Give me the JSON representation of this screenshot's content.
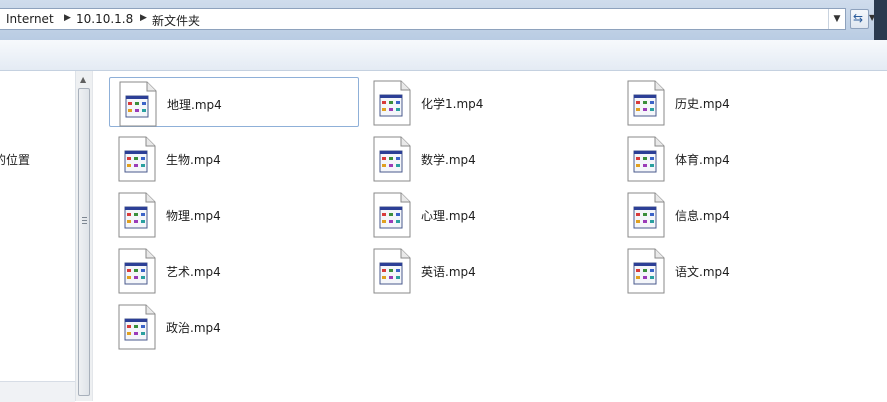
{
  "address": {
    "crumbs": [
      "Internet",
      "10.10.1.8",
      "新文件夹"
    ]
  },
  "nav": {
    "partial_item": "的位置"
  },
  "files": [
    {
      "name": "地理.mp4",
      "icon": "video-file-icon",
      "selected": true
    },
    {
      "name": "化学1.mp4",
      "icon": "video-file-icon"
    },
    {
      "name": "历史.mp4",
      "icon": "video-file-icon"
    },
    {
      "name": "生物.mp4",
      "icon": "video-file-icon"
    },
    {
      "name": "数学.mp4",
      "icon": "video-file-icon"
    },
    {
      "name": "体育.mp4",
      "icon": "video-file-icon"
    },
    {
      "name": "物理.mp4",
      "icon": "video-file-icon"
    },
    {
      "name": "心理.mp4",
      "icon": "video-file-icon"
    },
    {
      "name": "信息.mp4",
      "icon": "video-file-icon"
    },
    {
      "name": "艺术.mp4",
      "icon": "video-file-icon"
    },
    {
      "name": "英语.mp4",
      "icon": "video-file-icon"
    },
    {
      "name": "语文.mp4",
      "icon": "video-file-icon"
    },
    {
      "name": "政治.mp4",
      "icon": "video-file-icon"
    }
  ],
  "colors": {
    "selection_border": "#8fb0d8",
    "address_bar_bg": "#c4d5ea"
  }
}
